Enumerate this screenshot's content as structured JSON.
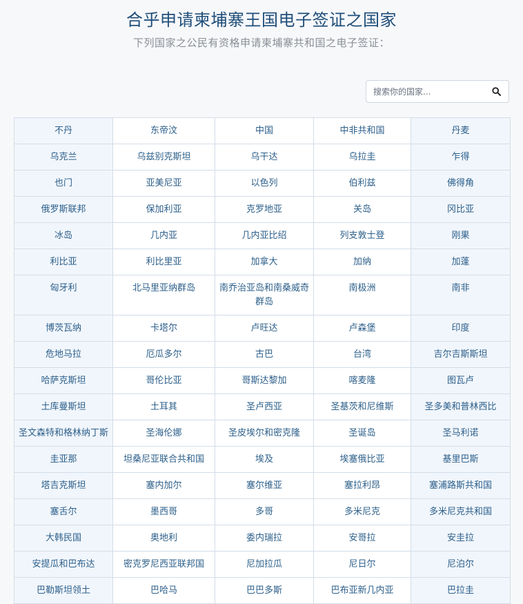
{
  "header": {
    "title": "合乎申请柬埔寨王国电子签证之国家",
    "subtitle": "下列国家之公民有资格申请柬埔寨共和国之电子签证："
  },
  "search": {
    "placeholder": "搜索你的国家...",
    "icon": "search-icon"
  },
  "colors": {
    "title": "#1f4e79",
    "link": "#2c5f8a",
    "border": "#d3dde7",
    "edge_column": "#f1f6fc"
  },
  "countries": [
    [
      "不丹",
      "东帝汶",
      "中国",
      "中非共和国",
      "丹麦"
    ],
    [
      "乌克兰",
      "乌兹别克斯坦",
      "乌干达",
      "乌拉圭",
      "乍得"
    ],
    [
      "也门",
      "亚美尼亚",
      "以色列",
      "伯利兹",
      "佛得角"
    ],
    [
      "俄罗斯联邦",
      "保加利亚",
      "克罗地亚",
      "关岛",
      "冈比亚"
    ],
    [
      "冰岛",
      "几内亚",
      "几内亚比绍",
      "列支敦士登",
      "刚果"
    ],
    [
      "利比亚",
      "利比里亚",
      "加拿大",
      "加纳",
      "加蓬"
    ],
    [
      "匈牙利",
      "北马里亚纳群岛",
      "南乔治亚岛和南桑威奇群岛",
      "南极洲",
      "南非"
    ],
    [
      "博茨瓦纳",
      "卡塔尔",
      "卢旺达",
      "卢森堡",
      "印度"
    ],
    [
      "危地马拉",
      "厄瓜多尔",
      "古巴",
      "台湾",
      "吉尔吉斯斯坦"
    ],
    [
      "哈萨克斯坦",
      "哥伦比亚",
      "哥斯达黎加",
      "喀麦隆",
      "图瓦卢"
    ],
    [
      "土库曼斯坦",
      "土耳其",
      "圣卢西亚",
      "圣基茨和尼维斯",
      "圣多美和普林西比"
    ],
    [
      "圣文森特和格林纳丁斯",
      "圣海伦娜",
      "圣皮埃尔和密克隆",
      "圣诞岛",
      "圣马利诺"
    ],
    [
      "圭亚那",
      "坦桑尼亚联合共和国",
      "埃及",
      "埃塞俄比亚",
      "基里巴斯"
    ],
    [
      "塔吉克斯坦",
      "塞内加尔",
      "塞尔维亚",
      "塞拉利昂",
      "塞浦路斯共和国"
    ],
    [
      "塞舌尔",
      "墨西哥",
      "多哥",
      "多米尼克",
      "多米尼克共和国"
    ],
    [
      "大韩民国",
      "奥地利",
      "委内瑞拉",
      "安哥拉",
      "安圭拉"
    ],
    [
      "安提瓜和巴布达",
      "密克罗尼西亚联邦国",
      "尼加拉瓜",
      "尼日尔",
      "尼泊尔"
    ],
    [
      "巴勒斯坦领土",
      "巴哈马",
      "巴巴多斯",
      "巴布亚新几内亚",
      "巴拉圭"
    ]
  ]
}
